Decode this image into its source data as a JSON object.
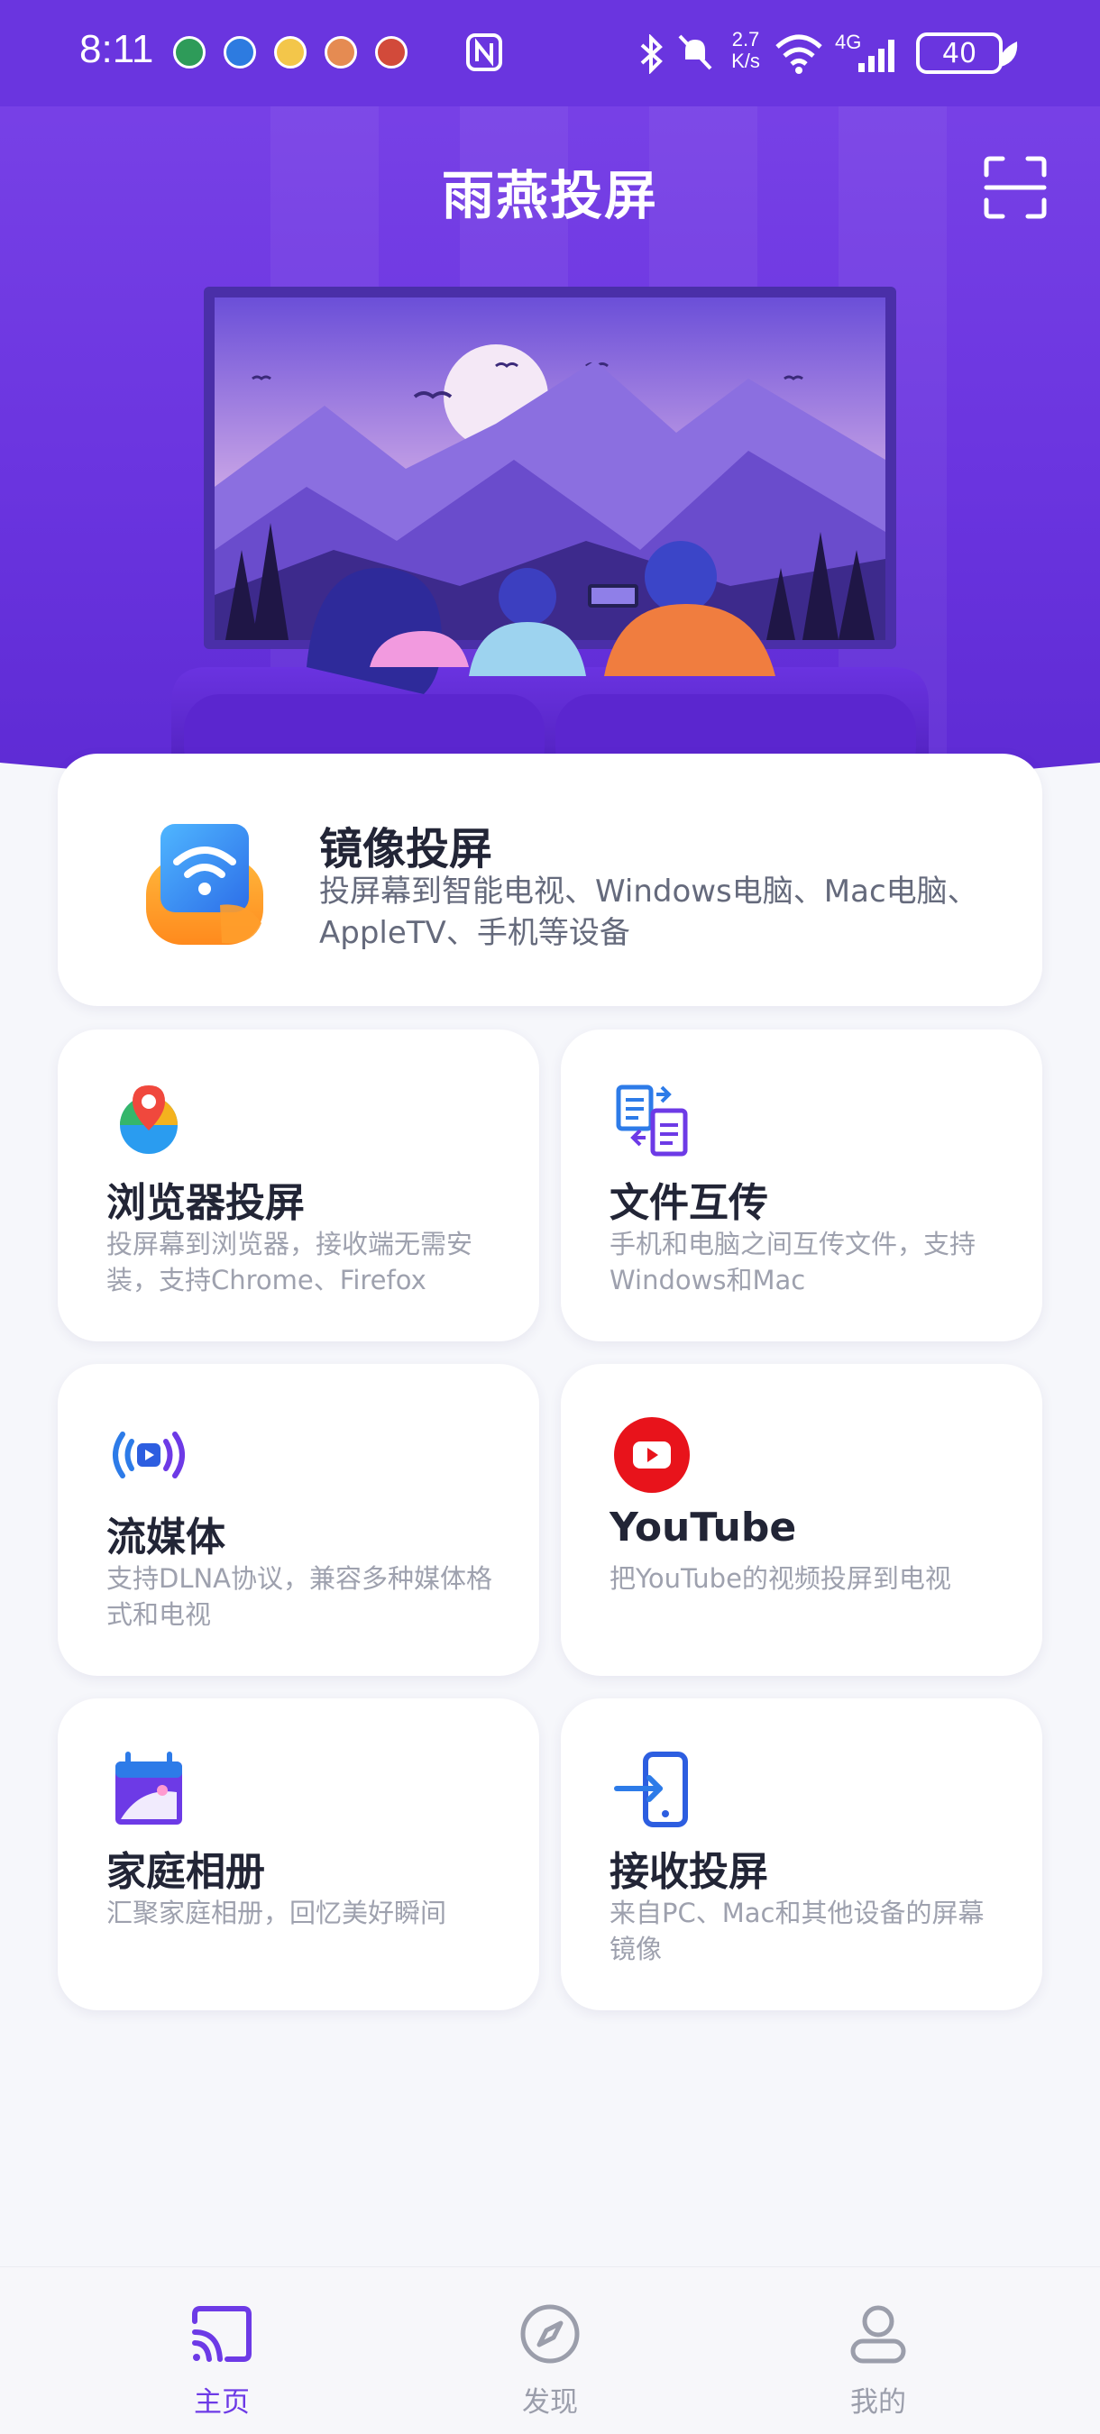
{
  "status_bar": {
    "time": "8:11",
    "net_speed_value": "2.7",
    "net_speed_unit": "K/s",
    "network": "4G",
    "battery": "40"
  },
  "header": {
    "title": "雨燕投屏",
    "scan_icon": "scan-icon"
  },
  "mirror_card": {
    "title": "镜像投屏",
    "description": "投屏幕到智能电视、Windows电脑、Mac电脑、AppleTV、手机等设备",
    "icon": "wifi-cast-icon"
  },
  "feature_cards": [
    {
      "title": "浏览器投屏",
      "description": "投屏幕到浏览器，接收端无需安装，支持Chrome、Firefox",
      "icon": "browser-icon"
    },
    {
      "title": "文件互传",
      "description": "手机和电脑之间互传文件，支持Windows和Mac",
      "icon": "file-transfer-icon"
    },
    {
      "title": "流媒体",
      "description": "支持DLNA协议，兼容多种媒体格式和电视",
      "icon": "streaming-icon"
    },
    {
      "title": "YouTube",
      "description": "把YouTube的视频投屏到电视",
      "icon": "youtube-icon"
    },
    {
      "title": "家庭相册",
      "description": "汇聚家庭相册，回忆美好瞬间",
      "icon": "album-icon"
    },
    {
      "title": "接收投屏",
      "description": "来自PC、Mac和其他设备的屏幕镜像",
      "icon": "receive-icon"
    }
  ],
  "bottom_nav": [
    {
      "label": "主页",
      "icon": "cast-icon",
      "active": true
    },
    {
      "label": "发现",
      "icon": "compass-icon",
      "active": false
    },
    {
      "label": "我的",
      "icon": "user-icon",
      "active": false
    }
  ],
  "colors": {
    "brand": "#6d3ae6",
    "hero_top": "#7b44e8",
    "youtube_red": "#e8131b",
    "muted_text": "#9ea1ae"
  }
}
